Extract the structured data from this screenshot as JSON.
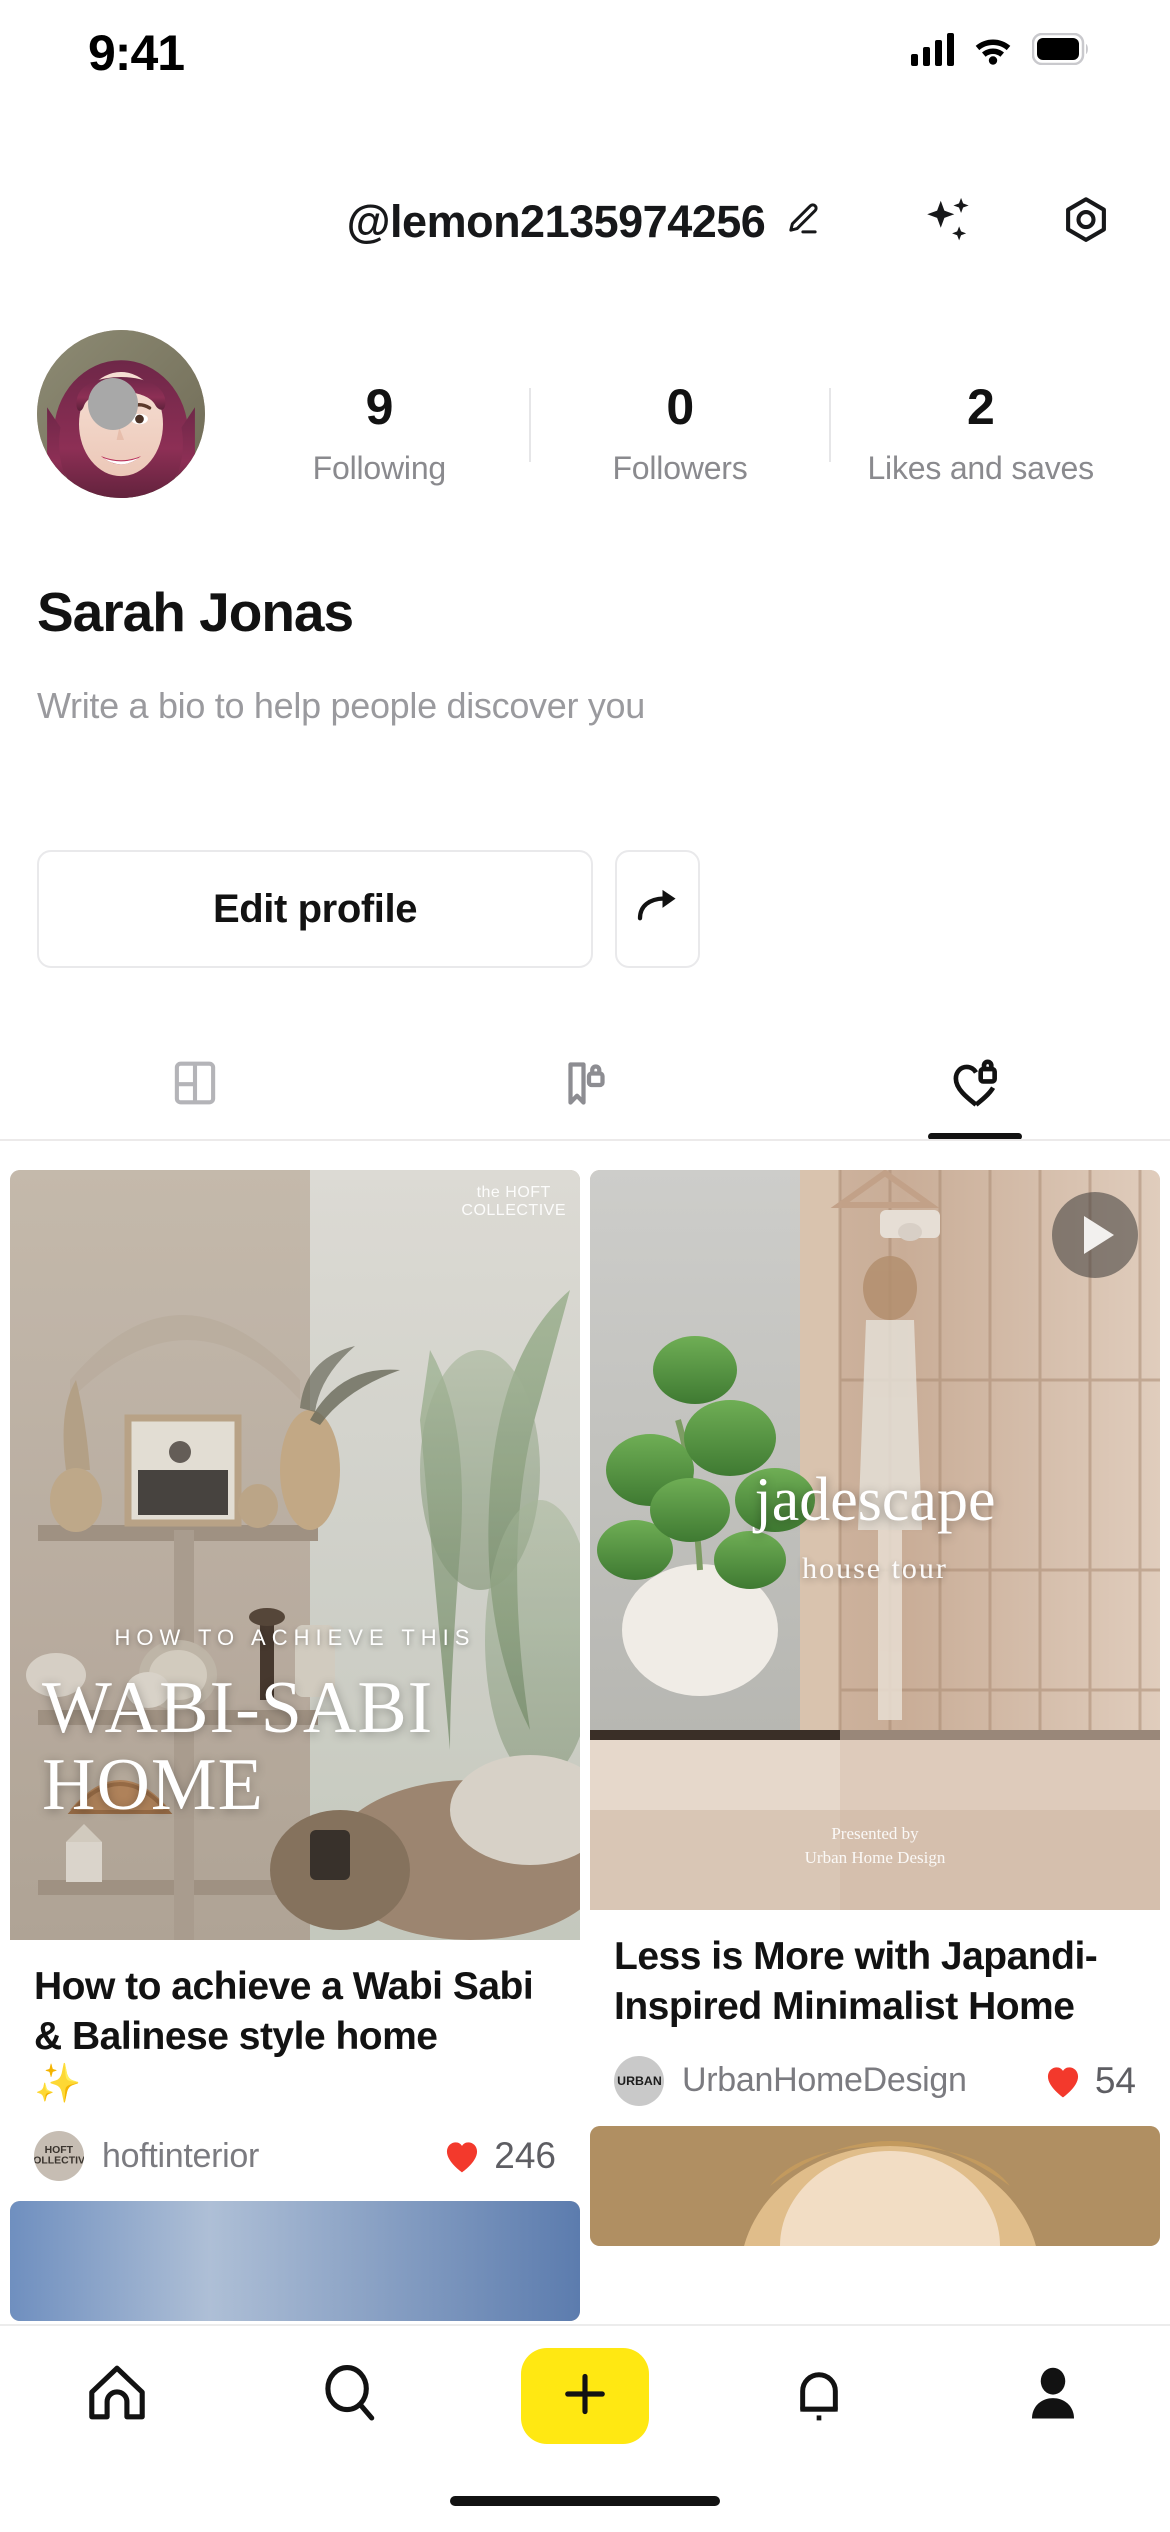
{
  "status_bar": {
    "time": "9:41",
    "cellular": "signal-bars-icon",
    "wifi": "wifi-icon",
    "battery": "battery-full-icon"
  },
  "header": {
    "handle": "@lemon2135974256",
    "edit_icon": "pencil-icon",
    "sparkle_icon": "sparkles-icon",
    "settings_icon": "hexagon-settings-icon"
  },
  "profile": {
    "display_name": "Sarah Jonas",
    "bio_placeholder": "Write a bio to help people discover you",
    "avatar": "user-avatar-photo",
    "stats": [
      {
        "value": "9",
        "label": "Following"
      },
      {
        "value": "0",
        "label": "Followers"
      },
      {
        "value": "2",
        "label": "Likes and saves"
      }
    ],
    "edit_profile_label": "Edit profile",
    "share_icon": "share-arrow-icon"
  },
  "tabs": [
    {
      "name": "posts",
      "icon": "grid-layout-icon",
      "active": false
    },
    {
      "name": "saved",
      "icon": "bookmark-lock-icon",
      "active": false
    },
    {
      "name": "liked",
      "icon": "heart-lock-icon",
      "active": true
    }
  ],
  "feed": {
    "left": [
      {
        "media": {
          "kicker": "HOW TO ACHIEVE THIS",
          "headline_line1": "WABI-SABI",
          "headline_line2": "HOME",
          "brand_line1": "the HOFT",
          "brand_line2": "COLLECTIVE"
        },
        "title": "How to achieve a Wabi Sabi & Balinese style home",
        "title_emoji": "✨",
        "author": "hoftinterior",
        "author_badge": "HOFT COLLECTIVE",
        "likes": "246",
        "like_icon": "heart-filled-icon"
      },
      {
        "media": {
          "partial": true
        }
      }
    ],
    "right": [
      {
        "media": {
          "overlay_title": "jadescape",
          "overlay_sub": "house tour",
          "presented_line1": "Presented by",
          "presented_line2": "Urban Home Design",
          "play_icon": "play-button-icon"
        },
        "title": "Less is More with Japandi-Inspired Minimalist Home",
        "author": "UrbanHomeDesign",
        "author_badge": "URBAN",
        "likes": "54",
        "like_icon": "heart-filled-icon"
      },
      {
        "media": {
          "partial": true
        }
      }
    ]
  },
  "bottom_nav": {
    "items": [
      {
        "name": "home",
        "icon": "home-icon"
      },
      {
        "name": "search",
        "icon": "search-icon"
      },
      {
        "name": "create",
        "icon": "plus-icon"
      },
      {
        "name": "notifications",
        "icon": "bell-icon"
      },
      {
        "name": "profile",
        "icon": "person-icon"
      }
    ],
    "accent_color": "#FFE812"
  },
  "colors": {
    "accent": "#FFE812",
    "heart": "#F3392C",
    "text": "#121212",
    "muted": "#8a8a8e"
  }
}
